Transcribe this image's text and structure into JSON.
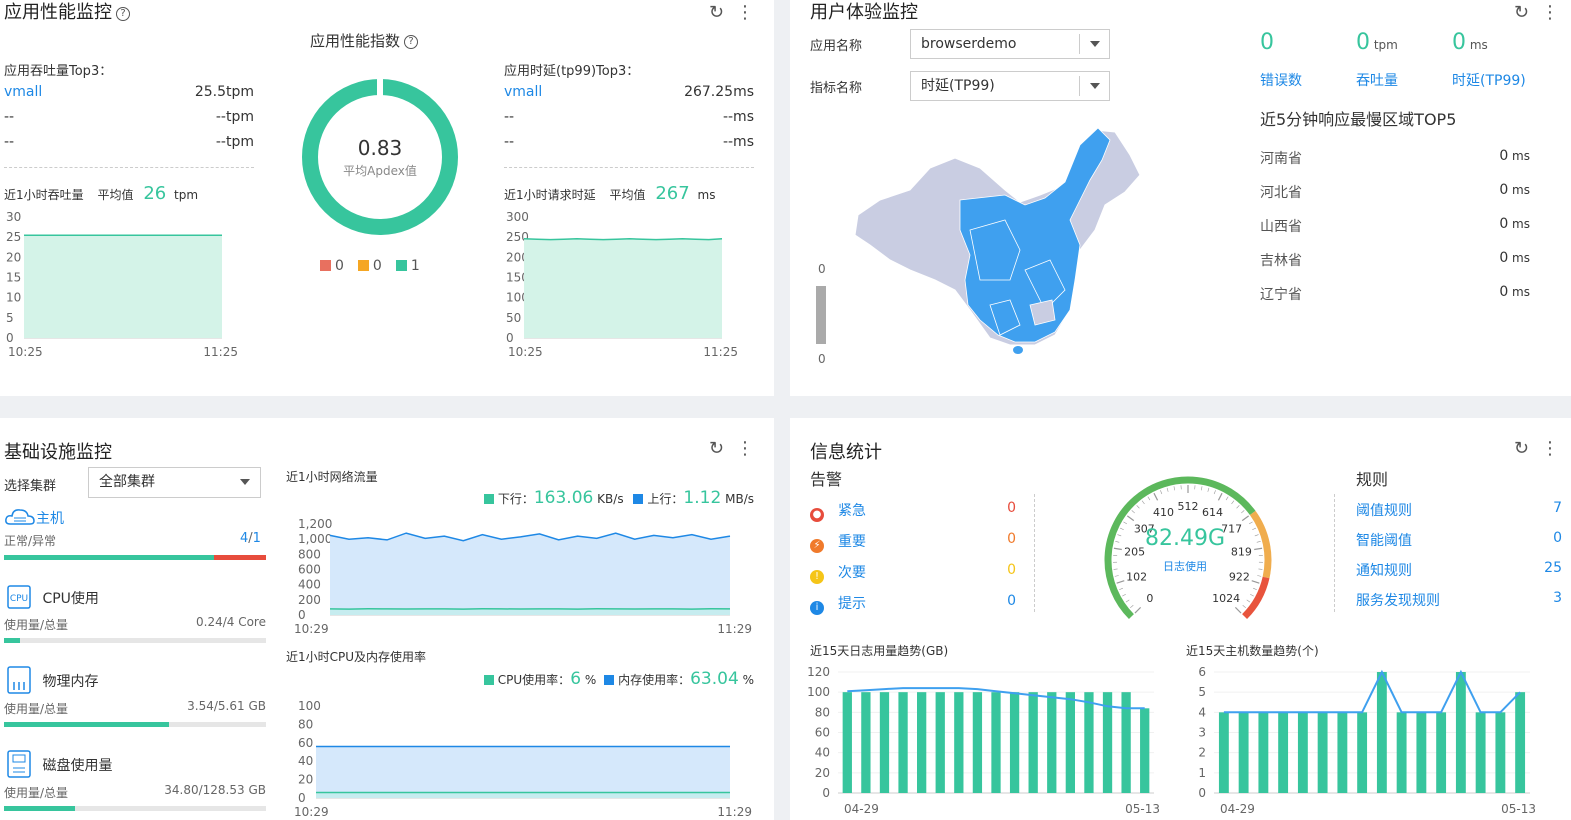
{
  "colors": {
    "green": "#37c59d",
    "blue": "#1e88e5",
    "red": "#e74c3c",
    "orange": "#f5a623",
    "map_blue": "#3fa0ef",
    "map_gray": "#c9cde2"
  },
  "apm": {
    "title": "应用性能监控",
    "throughput_top3": {
      "title": "应用吞吐量Top3：",
      "rows": [
        {
          "name": "vmall",
          "value": "25.5tpm"
        },
        {
          "name": "--",
          "value": "--tpm"
        },
        {
          "name": "--",
          "value": "--tpm"
        }
      ]
    },
    "latency_top3": {
      "title": "应用时延(tp99)Top3：",
      "rows": [
        {
          "name": "vmall",
          "value": "267.25ms"
        },
        {
          "name": "--",
          "value": "--ms"
        },
        {
          "name": "--",
          "value": "--ms"
        }
      ]
    },
    "apdex": {
      "title": "应用性能指数",
      "value": "0.83",
      "sublabel": "平均Apdex值",
      "legend": [
        {
          "color": "#e8705f",
          "value": "0"
        },
        {
          "color": "#f5a623",
          "value": "0"
        },
        {
          "color": "#37c59d",
          "value": "1"
        }
      ]
    },
    "throughput_trend": {
      "label": "近1小时吞吐量",
      "avg_label": "平均值",
      "avg_value": "26",
      "unit": "tpm"
    },
    "latency_trend": {
      "label": "近1小时请求时延",
      "avg_label": "平均值",
      "avg_value": "267",
      "unit": "ms"
    }
  },
  "ue": {
    "title": "用户体验监控",
    "app_label": "应用名称",
    "app_value": "browserdemo",
    "metric_label": "指标名称",
    "metric_value": "时延(TP99)",
    "stats": [
      {
        "value": "0",
        "unit": "",
        "label": "错误数"
      },
      {
        "value": "0",
        "unit": "tpm",
        "label": "吞吐量"
      },
      {
        "value": "0",
        "unit": "ms",
        "label": "时延(TP99)"
      }
    ],
    "map_scale_top": "0",
    "map_scale_bottom": "0",
    "top5_title": "近5分钟响应最慢区域TOP5",
    "top5": [
      {
        "region": "河南省",
        "value": "0",
        "unit": "ms"
      },
      {
        "region": "河北省",
        "value": "0",
        "unit": "ms"
      },
      {
        "region": "山西省",
        "value": "0",
        "unit": "ms"
      },
      {
        "region": "吉林省",
        "value": "0",
        "unit": "ms"
      },
      {
        "region": "辽宁省",
        "value": "0",
        "unit": "ms"
      }
    ]
  },
  "infra": {
    "title": "基础设施监控",
    "cluster_label": "选择集群",
    "cluster_value": "全部集群",
    "host": {
      "label": "主机",
      "sub": "正常/异常",
      "normal": "4",
      "total": "1",
      "fraction": 0.8
    },
    "cpu": {
      "label": "CPU使用",
      "sub": "使用量/总量",
      "used": "0.24",
      "total": "4 Core",
      "fraction": 0.06
    },
    "memory": {
      "label": "物理内存",
      "sub": "使用量/总量",
      "used": "3.54",
      "total": "5.61 GB",
      "fraction": 0.63
    },
    "disk": {
      "label": "磁盘使用量",
      "sub": "使用量/总量",
      "used": "34.80",
      "total": "128.53 GB",
      "fraction": 0.27
    },
    "network": {
      "title": "近1小时网络流量",
      "down_label": "下行：",
      "down_value": "163.06",
      "down_unit": "KB/s",
      "up_label": "上行：",
      "up_value": "1.12",
      "up_unit": "MB/s"
    },
    "cpu_mem": {
      "title": "近1小时CPU及内存使用率",
      "cpu_label": "CPU使用率：",
      "cpu_value": "6",
      "cpu_unit": "%",
      "mem_label": "内存使用率：",
      "mem_value": "63.04",
      "mem_unit": "%"
    }
  },
  "info": {
    "title": "信息统计",
    "alerts_title": "告警",
    "alerts": [
      {
        "label": "紧急",
        "value": "0",
        "color": "#e74c3c",
        "value_color": "#e74c3c"
      },
      {
        "label": "重要",
        "value": "0",
        "color": "#f07a2b",
        "value_color": "#f07a2b"
      },
      {
        "label": "次要",
        "value": "0",
        "color": "#f5c518",
        "value_color": "#f5c518"
      },
      {
        "label": "提示",
        "value": "0",
        "color": "#1e88e5",
        "value_color": "#1e88e5"
      }
    ],
    "gauge": {
      "value": "82.49G",
      "label": "日志使用",
      "fraction": 0.0805,
      "ticks": [
        "0",
        "102",
        "205",
        "307",
        "410",
        "512",
        "614",
        "717",
        "819",
        "922",
        "1024"
      ]
    },
    "rules_title": "规则",
    "rules": [
      {
        "label": "阈值规则",
        "value": "7"
      },
      {
        "label": "智能阈值",
        "value": "0"
      },
      {
        "label": "通知规则",
        "value": "25"
      },
      {
        "label": "服务发现规则",
        "value": "3"
      }
    ]
  },
  "chart_data": [
    {
      "id": "apm-throughput",
      "type": "area",
      "x_labels": [
        "10:25",
        "11:25"
      ],
      "ylim": [
        0,
        30
      ],
      "yticks": [
        "30",
        "25",
        "20",
        "15",
        "10",
        "5",
        "0"
      ],
      "series": [
        {
          "values": [
            25.5,
            25.5,
            25.5,
            25.5,
            25.5,
            25.5,
            25.5,
            25.5,
            25.5,
            25.5,
            25.5,
            25.5
          ]
        }
      ]
    },
    {
      "id": "apm-latency",
      "type": "area",
      "x_labels": [
        "10:25",
        "11:25"
      ],
      "ylim": [
        0,
        300
      ],
      "yticks": [
        "300",
        "250",
        "200",
        "150",
        "100",
        "50",
        "0"
      ],
      "series": [
        {
          "values": [
            246,
            245,
            244,
            245,
            246,
            245,
            244,
            245,
            246,
            245,
            244,
            245,
            246,
            245,
            244,
            246
          ]
        }
      ]
    },
    {
      "id": "network",
      "type": "area",
      "x_labels": [
        "10:29",
        "11:29"
      ],
      "ylim": [
        0,
        1200
      ],
      "yticks": [
        "1,200",
        "1,000",
        "800",
        "600",
        "400",
        "200",
        "0"
      ],
      "series": [
        {
          "name": "下行",
          "color": "#37c59d",
          "values": [
            80,
            78,
            82,
            80,
            79,
            81,
            80,
            78,
            82,
            80,
            79,
            81,
            80,
            78,
            82,
            80,
            79,
            81,
            80,
            78,
            82,
            80
          ]
        },
        {
          "name": "上行",
          "color": "#1e88e5",
          "values": [
            1050,
            1000,
            1020,
            990,
            1080,
            1010,
            1040,
            980,
            1060,
            1000,
            1030,
            1070,
            990,
            1040,
            1010,
            1080,
            1000,
            1050,
            1020,
            1060,
            1000,
            1040
          ]
        }
      ]
    },
    {
      "id": "cpu-mem",
      "type": "area",
      "x_labels": [
        "10:29",
        "11:29"
      ],
      "ylim": [
        0,
        100
      ],
      "yticks": [
        "100",
        "80",
        "60",
        "40",
        "20",
        "0"
      ],
      "series": [
        {
          "name": "CPU使用率",
          "color": "#37c59d",
          "values": [
            6,
            6,
            6,
            6,
            6,
            6,
            6,
            6,
            6,
            6,
            6,
            6
          ]
        },
        {
          "name": "内存使用率",
          "color": "#1e88e5",
          "values": [
            56,
            56,
            56,
            56,
            56,
            56,
            56,
            56,
            56,
            56,
            56,
            56
          ]
        }
      ]
    },
    {
      "id": "log-trend",
      "type": "bar",
      "title": "近15天日志用量趋势(GB)",
      "x_labels": [
        "04-29",
        "05-13"
      ],
      "ylim": [
        0,
        120
      ],
      "yticks": [
        "120",
        "100",
        "80",
        "60",
        "40",
        "20",
        "0"
      ],
      "values": [
        101,
        102,
        103,
        104,
        104,
        104,
        104,
        103,
        101,
        99,
        97,
        95,
        93,
        90,
        86,
        84,
        84
      ],
      "bars": [
        100,
        100,
        100,
        100,
        100,
        100,
        100,
        100,
        100,
        100,
        100,
        100,
        100,
        100,
        100,
        100,
        84
      ]
    },
    {
      "id": "host-trend",
      "type": "bar",
      "title": "近15天主机数量趋势(个)",
      "x_labels": [
        "04-29",
        "05-13"
      ],
      "ylim": [
        0,
        6
      ],
      "yticks": [
        "6",
        "5",
        "4",
        "3",
        "2",
        "1",
        "0"
      ],
      "bars": [
        4,
        4,
        4,
        4,
        4,
        4,
        4,
        4,
        6,
        4,
        4,
        4,
        6,
        4,
        4,
        5
      ],
      "values": [
        4,
        4,
        4,
        4,
        4,
        4,
        4,
        4,
        6,
        4,
        4,
        4,
        6,
        4,
        4,
        5
      ]
    }
  ]
}
